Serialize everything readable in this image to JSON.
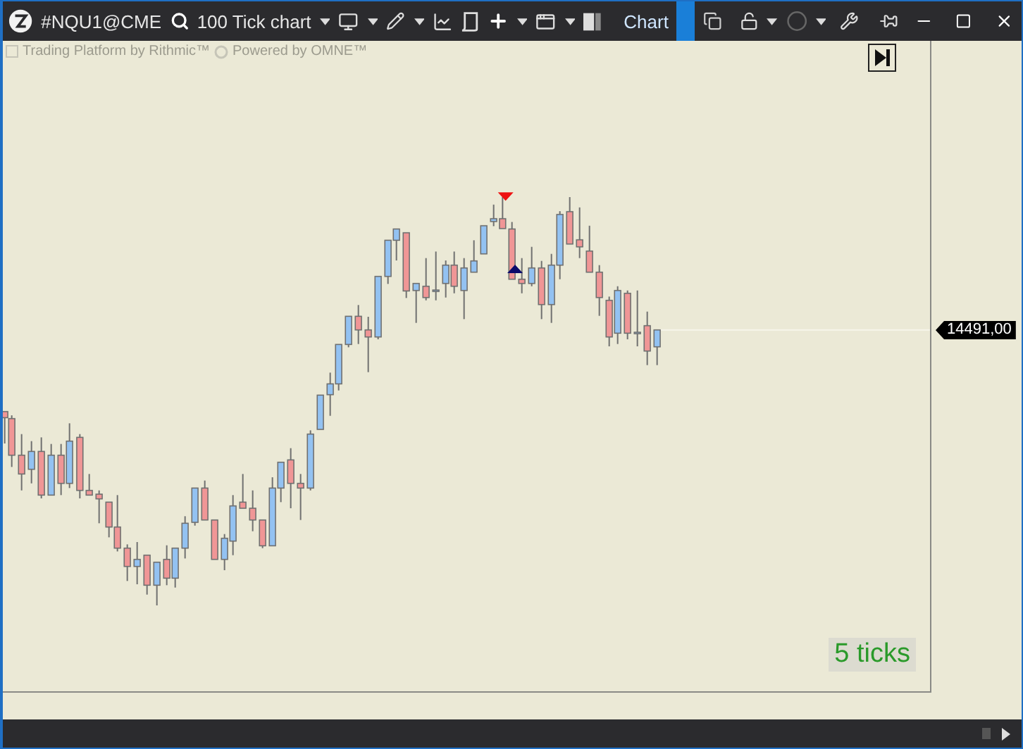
{
  "toolbar": {
    "symbol": "#NQU1@CME",
    "chart_type": "100 Tick chart",
    "chart_label": "Chart"
  },
  "chart": {
    "branding": "Trading Platform by Rithmic™",
    "powered_by": "Powered by OMNE™",
    "last_price": "14491,00",
    "tick_counter": "5 ticks"
  }
}
